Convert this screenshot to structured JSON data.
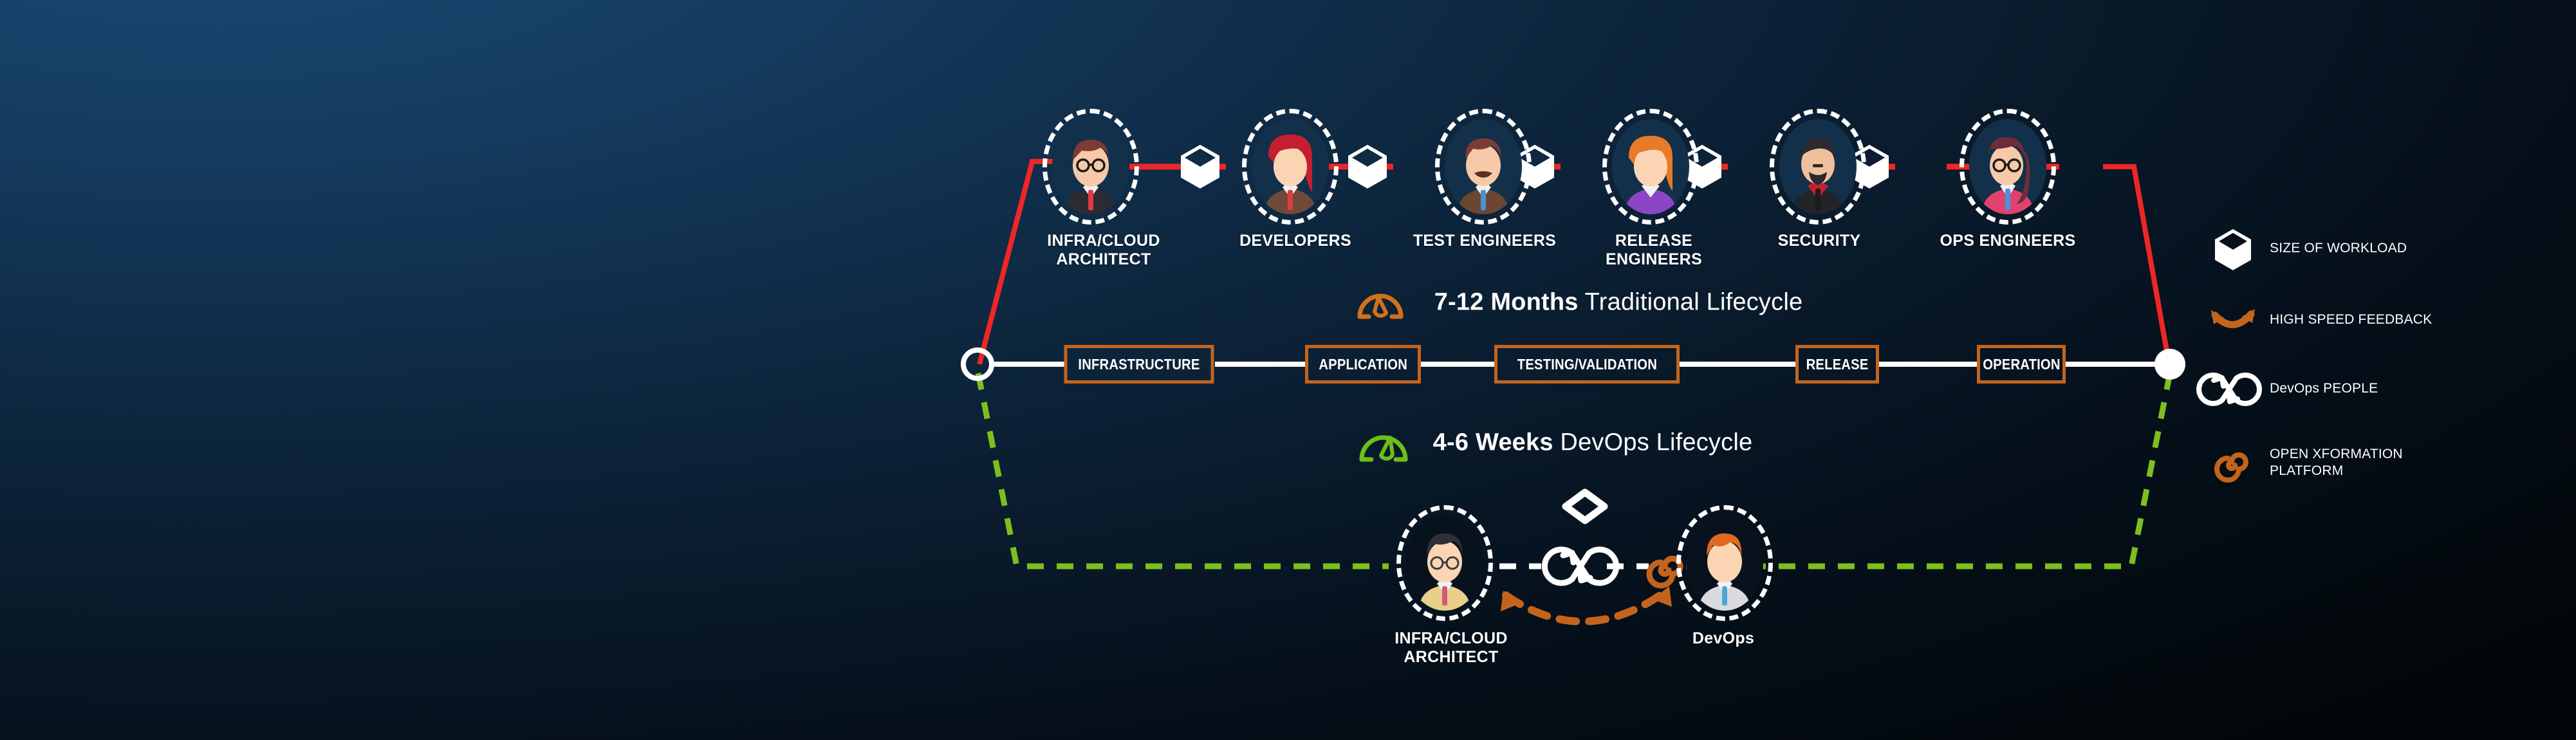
{
  "theme": {
    "bg_top_left": "#1b4871",
    "bg_bottom_right": "#020608",
    "traditional_line": "#ef2626",
    "devops_line": "#7dbf1f",
    "pipeline_border": "#c4641c",
    "feedback_arrow": "#c4641c",
    "white": "#ffffff"
  },
  "traditional": {
    "caption_bold": "7-12 Months",
    "caption_rest": " Traditional Lifecycle",
    "gauge_icon": "speedometer-slow-icon",
    "gauge_color": "#d2711c",
    "roles": [
      {
        "label": "INFRA/CLOUD\nARCHITECT",
        "avatar": "architect-avatar"
      },
      {
        "label": "DEVELOPERS",
        "avatar": "developer-avatar"
      },
      {
        "label": "TEST ENGINEERS",
        "avatar": "test-engineer-avatar"
      },
      {
        "label": "RELEASE\nENGINEERS",
        "avatar": "release-engineer-avatar"
      },
      {
        "label": "SECURITY",
        "avatar": "security-avatar"
      },
      {
        "label": "OPS ENGINEERS",
        "avatar": "ops-engineer-avatar"
      }
    ],
    "workload_cubes": 5
  },
  "pipeline": {
    "stages": [
      {
        "label": "INFRASTRUCTURE"
      },
      {
        "label": "APPLICATION"
      },
      {
        "label": "TESTING/VALIDATION"
      },
      {
        "label": "RELEASE"
      },
      {
        "label": "OPERATION"
      }
    ],
    "start_node": "hollow-circle-node",
    "end_node": "filled-circle-node"
  },
  "devops": {
    "caption_bold": "4-6 Weeks",
    "caption_rest": " DevOps Lifecycle",
    "gauge_icon": "speedometer-fast-icon",
    "gauge_color": "#6cbf1a",
    "roles": [
      {
        "label": "INFRA/CLOUD\nARCHITECT",
        "avatar": "devops-architect-avatar"
      },
      {
        "label": "DevOps",
        "avatar": "devops-engineer-avatar"
      }
    ],
    "workload_cube": "flat-diamond-icon",
    "infinity_icon": "devops-infinity-icon",
    "platform_icon": "open-xformation-spiral-icon",
    "feedback_icon": "high-speed-feedback-arrow-icon"
  },
  "legend": {
    "items": [
      {
        "icon": "cube-icon",
        "label": "SIZE OF WORKLOAD",
        "color": "#ffffff"
      },
      {
        "icon": "curved-arrow-icon",
        "label": "HIGH SPEED FEEDBACK",
        "color": "#c4641c"
      },
      {
        "icon": "infinity-icon",
        "label": "DevOps PEOPLE",
        "color": "#ffffff"
      },
      {
        "icon": "spiral-icon",
        "label": "OPEN XFORMATION\nPLATFORM",
        "color": "#c4641c"
      }
    ]
  }
}
